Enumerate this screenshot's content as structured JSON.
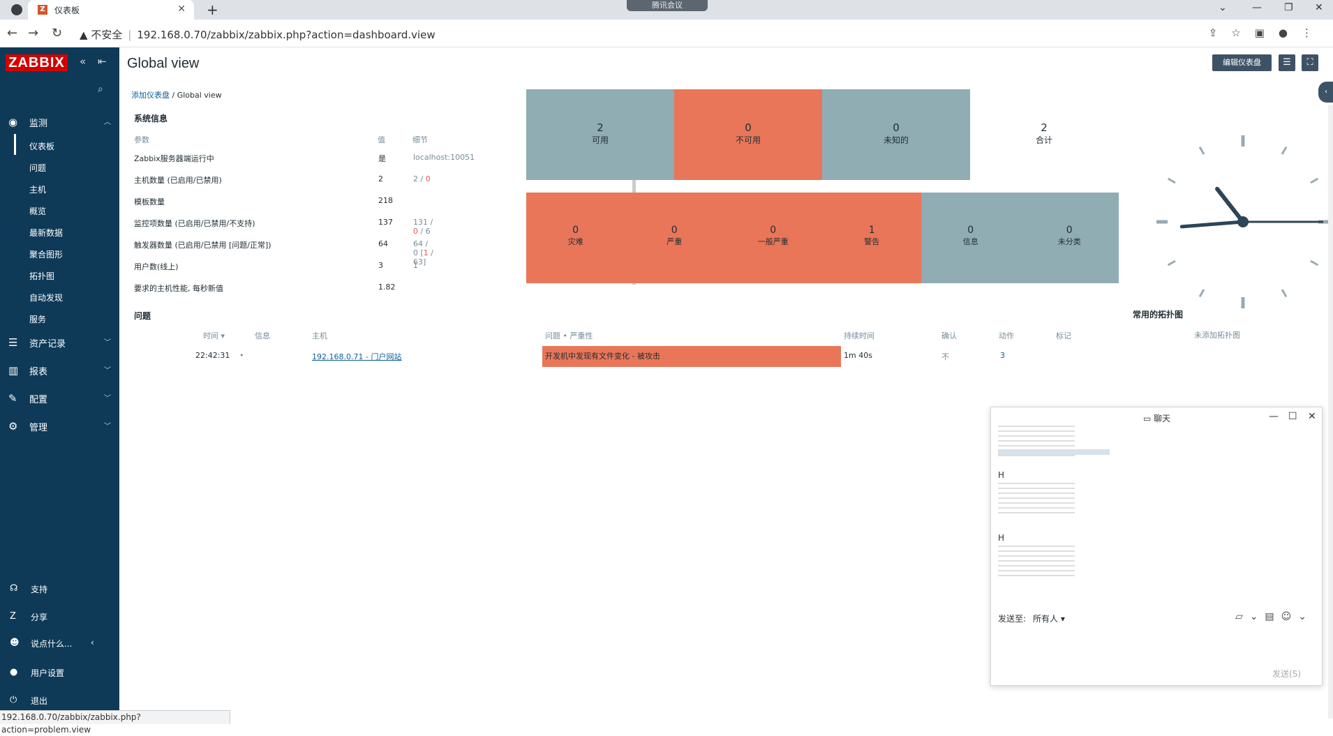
{
  "browser": {
    "tab_title": "仪表板",
    "favicon_letter": "Z",
    "meeting_label": "腾讯会议",
    "security_label": "不安全",
    "url": "192.168.0.70/zabbix/zabbix.php?action=dashboard.view",
    "status_url": "192.168.0.70/zabbix/zabbix.php?action=problem.view"
  },
  "sidebar": {
    "logo": "ZABBIX",
    "sections": [
      {
        "label": "监测",
        "icon": "eye-icon"
      },
      {
        "label": "资产记录",
        "icon": "list-icon"
      },
      {
        "label": "报表",
        "icon": "chart-icon"
      },
      {
        "label": "配置",
        "icon": "wrench-icon"
      },
      {
        "label": "管理",
        "icon": "gear-icon"
      }
    ],
    "monitoring_items": [
      "仪表板",
      "问题",
      "主机",
      "概览",
      "最新数据",
      "聚合图形",
      "拓扑图",
      "自动发现",
      "服务"
    ],
    "bottom": {
      "support": "支持",
      "share": "分享",
      "feedback": "说点什么...",
      "user_settings": "用户设置",
      "logout": "退出"
    }
  },
  "header": {
    "title": "Global view",
    "edit_button": "编辑仪表盘",
    "breadcrumb_parent": "添加仪表盘",
    "breadcrumb_current": "Global view"
  },
  "sysinfo": {
    "title": "系统信息",
    "col_param": "参数",
    "col_value": "值",
    "col_detail": "细节",
    "rows": [
      {
        "param": "Zabbix服务器端运行中",
        "value": "是",
        "detail_a": "localhost:10051",
        "detail_b": "",
        "detail_c": ""
      },
      {
        "param": "主机数量 (已启用/已禁用)",
        "value": "2",
        "detail_a": "2 / ",
        "detail_b": "0",
        "detail_c": ""
      },
      {
        "param": "模板数量",
        "value": "218",
        "detail_a": "",
        "detail_b": "",
        "detail_c": ""
      },
      {
        "param": "监控项数量 (已启用/已禁用/不支持)",
        "value": "137",
        "detail_a": "131 / ",
        "detail_b": "0",
        "detail_c": " / 6"
      },
      {
        "param": "触发器数量 (已启用/已禁用 [问题/正常])",
        "value": "64",
        "detail_a": "64 / 0 [",
        "detail_b": "1",
        "detail_c": " / 63]"
      },
      {
        "param": "用户数(线上)",
        "value": "3",
        "detail_a": "1",
        "detail_b": "",
        "detail_c": ""
      },
      {
        "param": "要求的主机性能, 每秒新值",
        "value": "1.82",
        "detail_a": "",
        "detail_b": "",
        "detail_c": ""
      }
    ]
  },
  "host_availability": [
    {
      "count": "2",
      "label": "可用",
      "color": "#8fadb3"
    },
    {
      "count": "0",
      "label": "不可用",
      "color": "#e97659"
    },
    {
      "count": "0",
      "label": "未知的",
      "color": "#8fadb3"
    },
    {
      "count": "2",
      "label": "合计",
      "color": "#ffffff"
    }
  ],
  "problem_severity": [
    {
      "count": "0",
      "label": "灾难",
      "color": "#e97659"
    },
    {
      "count": "0",
      "label": "严重",
      "color": "#e97659"
    },
    {
      "count": "0",
      "label": "一般严重",
      "color": "#e97659"
    },
    {
      "count": "1",
      "label": "警告",
      "color": "#e97659"
    },
    {
      "count": "0",
      "label": "信息",
      "color": "#8fadb3"
    },
    {
      "count": "0",
      "label": "未分类",
      "color": "#8fadb3"
    }
  ],
  "problems": {
    "title": "问题",
    "headers": {
      "time": "时间 ▾",
      "info": "信息",
      "host": "主机",
      "problem": "问题 • 严重性",
      "duration": "持续时间",
      "ack": "确认",
      "actions": "动作",
      "tags": "标记"
    },
    "rows": [
      {
        "time": "22:42:31",
        "host": "192.168.0.71 - 门户网站",
        "problem": "开发机中发现有文件变化 - 被攻击",
        "duration": "1m 40s",
        "ack": "不",
        "actions": "3"
      }
    ]
  },
  "maps": {
    "title": "常用的拓扑图",
    "empty": "未添加拓扑图"
  },
  "clock": {
    "hour": 10,
    "minute": 44,
    "second": 15
  },
  "chat": {
    "title": "聊天",
    "sender_initial_1": "H",
    "sender_initial_2": "H",
    "send_to_label": "发送至:",
    "send_to_value": "所有人 ▾",
    "send_button": "发送(S)"
  }
}
